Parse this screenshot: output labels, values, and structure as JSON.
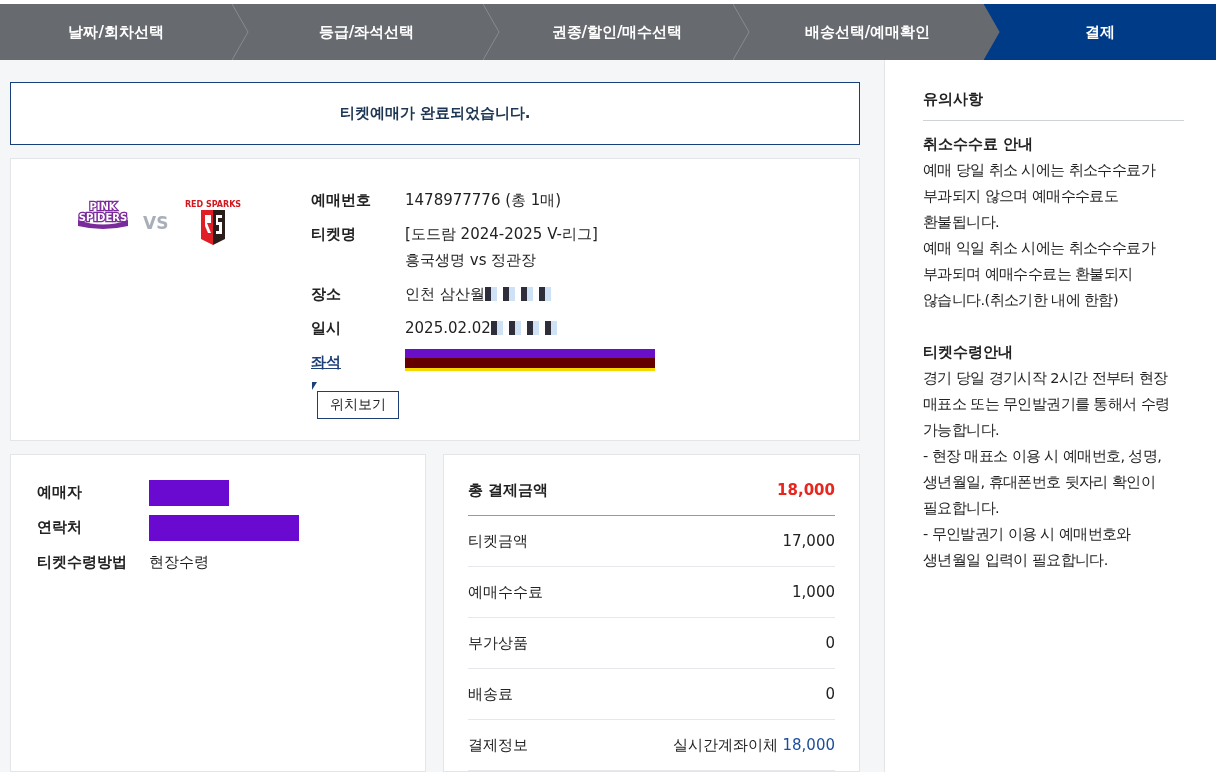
{
  "steps": [
    {
      "label": "날짜/회차선택",
      "selected": false
    },
    {
      "label": "등급/좌석선택",
      "selected": false
    },
    {
      "label": "권종/할인/매수선택",
      "selected": false
    },
    {
      "label": "배송선택/예매확인",
      "selected": false
    },
    {
      "label": "결제",
      "selected": true
    }
  ],
  "notice": "티켓예매가 완료되었습니다.",
  "match": {
    "home": {
      "kind": "pink",
      "lines": [
        "PINK",
        "SPIDERS"
      ]
    },
    "versus": "VS",
    "away": {
      "kind": "red",
      "caption": "RED SPARKS"
    }
  },
  "booking": [
    {
      "label": "예매번호",
      "lines": [
        "1478977776 (총 1매)"
      ]
    },
    {
      "label": "티켓명",
      "lines": [
        "[도드람 2024-2025 V-리그]",
        "흥국생명 vs 정관장"
      ]
    },
    {
      "label": "장소",
      "lines": [
        "인천 삼산월"
      ],
      "redacted": true
    },
    {
      "label": "일시",
      "lines": [
        "2025.02.02"
      ],
      "redacted": true
    },
    {
      "label": "좌석",
      "link": true,
      "redacted": true
    }
  ],
  "location_button": "위치보기",
  "buyer": [
    {
      "label": "예매자",
      "redacted": true
    },
    {
      "label": "연락처",
      "redacted": true
    },
    {
      "label": "티켓수령방법",
      "value": "현장수령"
    }
  ],
  "payment": [
    {
      "label": "총 결제금액",
      "value": "18,000",
      "kind": "total"
    },
    {
      "label": "티켓금액",
      "value": "17,000",
      "kind": "row"
    },
    {
      "label": "예매수수료",
      "value": "1,000",
      "kind": "row"
    },
    {
      "label": "부가상품",
      "value": "0",
      "kind": "row"
    },
    {
      "label": "배송료",
      "value": "0",
      "kind": "row"
    },
    {
      "label": "결제정보",
      "value": "실시간계좌이체",
      "amount": "18,000",
      "kind": "row"
    }
  ],
  "notes": {
    "title": "유의사항",
    "sections": [
      {
        "heading": "취소수수료 안내",
        "paragraphs": [
          "예매 당일 취소 시에는 취소수수료가 부과되지 않으며 예매수수료도 환불됩니다.",
          "예매 익일 취소 시에는 취소수수료가 부과되며 예매수수료는 환불되지 않습니다.(취소기한 내에 한함)"
        ]
      },
      {
        "heading": "티켓수령안내",
        "paragraphs": [
          "경기 당일 경기시작 2시간 전부터 현장 매표소 또는 무인발권기를 통해서 수령 가능합니다.",
          "- 현장 매표소 이용 시 예매번호, 성명, 생년월일, 휴대폰번호 뒷자리 확인이 필요합니다.",
          "- 무인발권기 이용 시 예매번호와 생년월일 입력이 필요합니다."
        ]
      }
    ]
  }
}
